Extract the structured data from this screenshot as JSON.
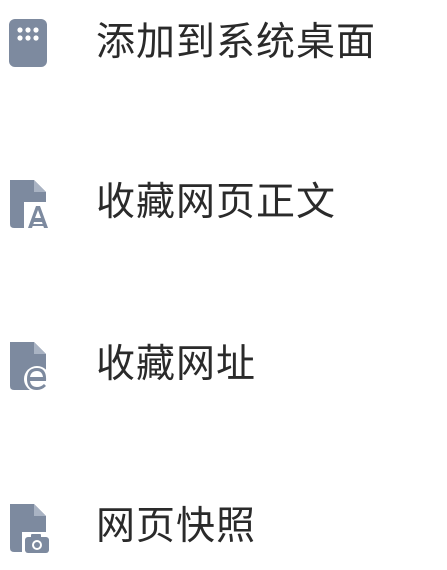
{
  "menu": {
    "items": [
      {
        "label": "添加到系统桌面",
        "icon": "phone-apps-grid-icon"
      },
      {
        "label": "收藏网页正文",
        "icon": "document-font-icon"
      },
      {
        "label": "收藏网址",
        "icon": "document-browser-icon"
      },
      {
        "label": "网页快照",
        "icon": "document-camera-icon"
      }
    ]
  },
  "colors": {
    "icon": "#7d8a9f",
    "text": "#2a2a2a",
    "background": "#ffffff"
  }
}
